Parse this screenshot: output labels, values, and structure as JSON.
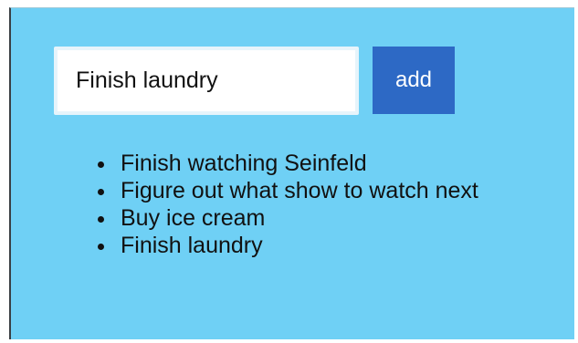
{
  "todo_form": {
    "input_value": "Finish laundry",
    "add_label": "add"
  },
  "todo_list": {
    "items": [
      "Finish watching Seinfeld",
      "Figure out what show to watch next",
      "Buy ice cream",
      "Finish laundry"
    ]
  },
  "colors": {
    "background": "#6fd0f5",
    "button": "#2d69c5",
    "button_text": "#ffffff",
    "input_background": "#ffffff",
    "text": "#111111"
  }
}
